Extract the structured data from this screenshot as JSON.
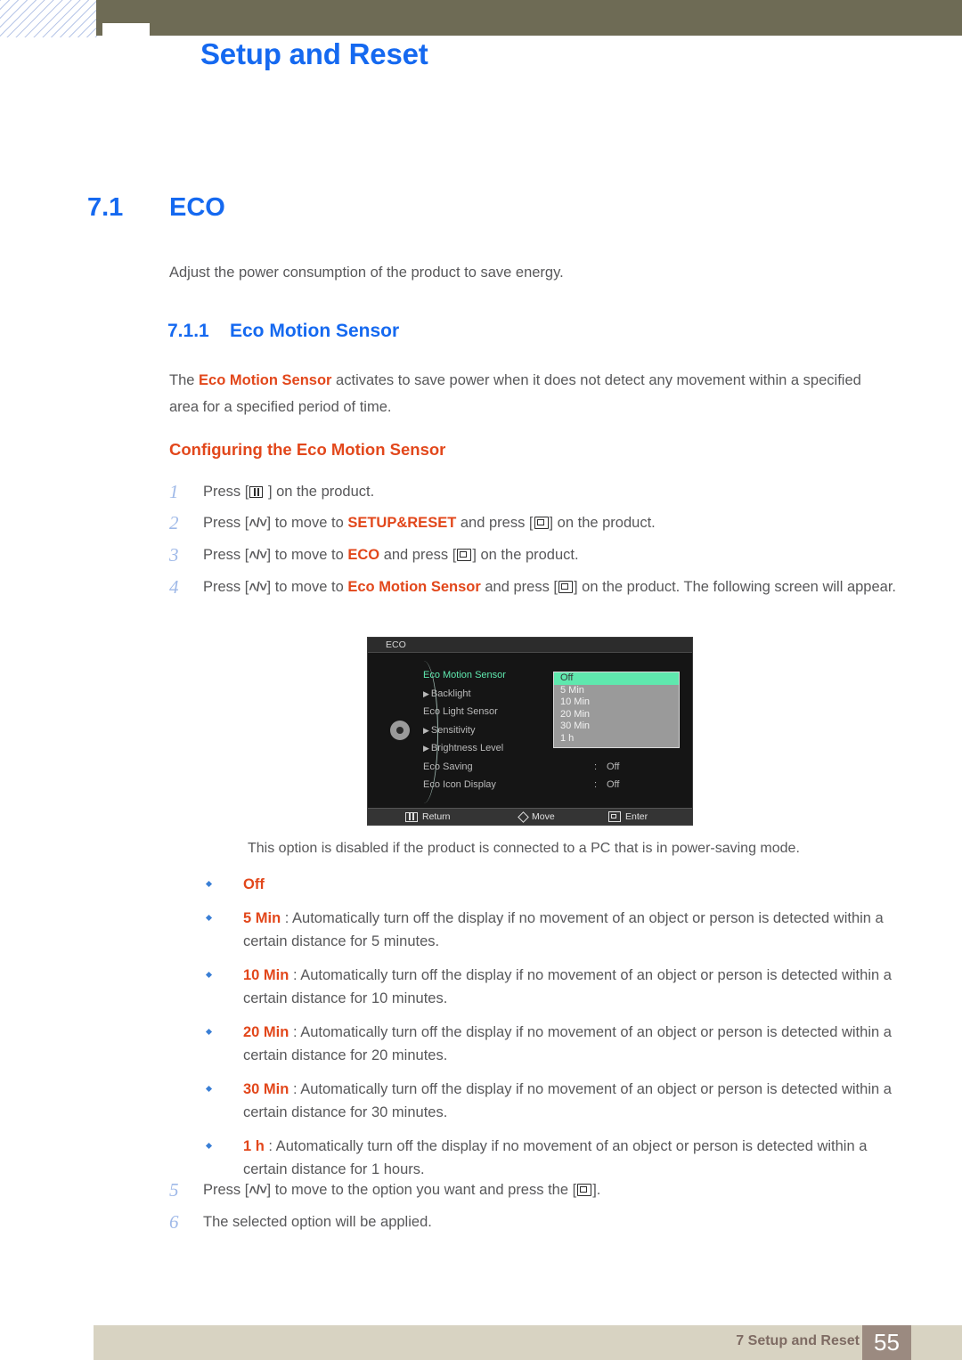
{
  "header": {
    "chapter_title": "Setup and Reset"
  },
  "section": {
    "number": "7.1",
    "title": "ECO",
    "intro": "Adjust the power consumption of the product to save energy."
  },
  "subsection": {
    "number": "7.1.1",
    "title": "Eco Motion Sensor",
    "para_pre": "The ",
    "para_term": "Eco Motion Sensor",
    "para_post": " activates to save power when it does not detect any movement within a specified area for a specified period of time.",
    "config_heading": "Configuring the Eco Motion Sensor"
  },
  "steps": [
    {
      "n": "1",
      "pre": "Press [",
      "icon": "menu-key-icon",
      "post": " ] on the product.",
      "mid": "",
      "term": "",
      "icon2": "",
      "tail": ""
    },
    {
      "n": "2",
      "pre": "Press [",
      "icon": "up-down-key-icon",
      "mid": "] to move to ",
      "term": "SETUP&RESET",
      "post": " and press [",
      "icon2": "enter-key-icon",
      "tail": "] on the product."
    },
    {
      "n": "3",
      "pre": "Press [",
      "icon": "up-down-key-icon",
      "mid": "] to move to ",
      "term": "ECO",
      "post": " and press [",
      "icon2": "enter-key-icon",
      "tail": "] on the product."
    },
    {
      "n": "4",
      "pre": "Press [",
      "icon": "up-down-key-icon",
      "mid": "] to move to ",
      "term": "Eco Motion Sensor",
      "post": " and press [",
      "icon2": "enter-key-icon",
      "tail": "] on the product. The following screen will appear."
    }
  ],
  "steps_after": [
    {
      "n": "5",
      "pre": "Press [",
      "icon": "up-down-key-icon",
      "mid": "] to move to the option you want and press the [",
      "icon2": "enter-key-icon",
      "tail": "]."
    },
    {
      "n": "6",
      "text": "The selected option will be applied."
    }
  ],
  "osd": {
    "title": "ECO",
    "rows": [
      {
        "label": "Eco Motion Sensor",
        "colon": ":",
        "value": "",
        "arrow": false,
        "selected": true
      },
      {
        "label": "Backlight",
        "colon": "",
        "value": "",
        "arrow": true,
        "selected": false
      },
      {
        "label": "Eco Light Sensor",
        "colon": ":",
        "value": "",
        "arrow": false,
        "selected": false
      },
      {
        "label": "Sensitivity",
        "colon": "",
        "value": "",
        "arrow": true,
        "selected": false
      },
      {
        "label": "Brightness Level",
        "colon": "",
        "value": "",
        "arrow": true,
        "selected": false
      },
      {
        "label": "Eco Saving",
        "colon": ":",
        "value": "Off",
        "arrow": false,
        "selected": false
      },
      {
        "label": "Eco Icon Display",
        "colon": ":",
        "value": "Off",
        "arrow": false,
        "selected": false
      }
    ],
    "dropdown": {
      "options": [
        "Off",
        "5 Min",
        "10 Min",
        "20 Min",
        "30 Min",
        "1 h"
      ],
      "active_index": 0
    },
    "footer": [
      {
        "icon": "menu-key-icon",
        "label": "Return"
      },
      {
        "icon": "diamond-move-icon",
        "label": "Move"
      },
      {
        "icon": "enter-key-icon",
        "label": "Enter"
      }
    ],
    "colors": {
      "highlight": "#5fe8ae",
      "dropdown_bg": "#9a9a9a",
      "panel_bg": "#151515"
    }
  },
  "note": "This option is disabled if the product is connected to a PC that is in power-saving mode.",
  "bullets": [
    {
      "term": "Off",
      "desc": ""
    },
    {
      "term": "5 Min",
      "desc": " : Automatically turn off the display if no movement of an object or person is detected within a certain distance for 5 minutes."
    },
    {
      "term": "10 Min",
      "desc": " : Automatically turn off the display if no movement of an object or person is detected within a certain distance for 10 minutes."
    },
    {
      "term": "20 Min",
      "desc": " : Automatically turn off the display if no movement of an object or person is detected within a certain distance for 20 minutes."
    },
    {
      "term": "30 Min",
      "desc": " : Automatically turn off the display if no movement of an object or person is detected within a certain distance for 30 minutes."
    },
    {
      "term": "1 h",
      "desc": " : Automatically turn off the display if no movement of an object or person is detected within a certain distance for 1 hours."
    }
  ],
  "footer": {
    "label": "7 Setup and Reset",
    "page": "55"
  },
  "theme": {
    "heading_blue": "#1569f0",
    "accent_orange": "#e2471b",
    "olive": "#6e6b55",
    "footer_beige": "#d8d3c2",
    "footer_brown": "#9b8a80",
    "bullet_blue": "#3a7fd5"
  }
}
